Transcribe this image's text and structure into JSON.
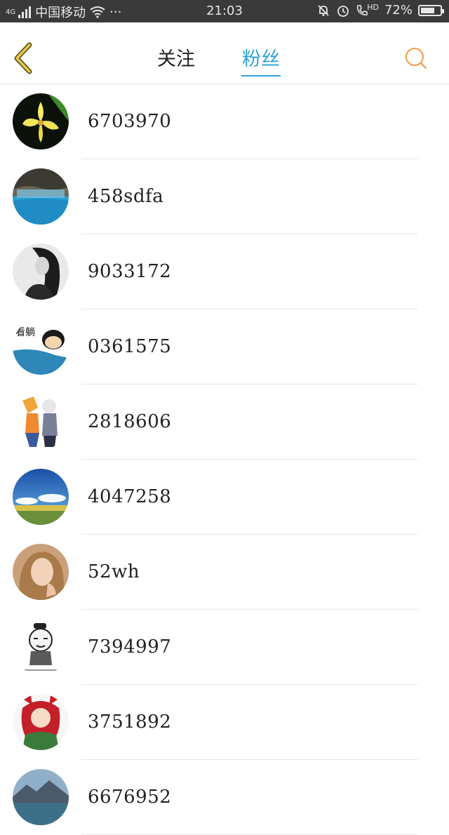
{
  "status_bar": {
    "network": "4G",
    "carrier": "中国移动",
    "more": "···",
    "time": "21:03",
    "hd": "HD",
    "battery_text": "72%",
    "battery_level": 0.72
  },
  "header": {
    "tabs": [
      {
        "label": "关注",
        "active": false
      },
      {
        "label": "粉丝",
        "active": true
      }
    ],
    "accent_color": "#2ba2d2",
    "search_icon_color": "#f29a4a",
    "back_icon_color": "#e2b93a"
  },
  "fans": [
    {
      "name": "6703970",
      "avatar": "yellow-flower"
    },
    {
      "name": "458sdfa",
      "avatar": "blue-water-text"
    },
    {
      "name": "9033172",
      "avatar": "bw-girl"
    },
    {
      "name": "0361575",
      "avatar": "cartoon-face"
    },
    {
      "name": "2818606",
      "avatar": "anime-duo"
    },
    {
      "name": "4047258",
      "avatar": "blue-sky-field"
    },
    {
      "name": "52wh",
      "avatar": "girl-portrait"
    },
    {
      "name": "7394997",
      "avatar": "cartoon-meme"
    },
    {
      "name": "3751892",
      "avatar": "anime-girl-red"
    },
    {
      "name": "6676952",
      "avatar": "mountain-lake"
    }
  ]
}
